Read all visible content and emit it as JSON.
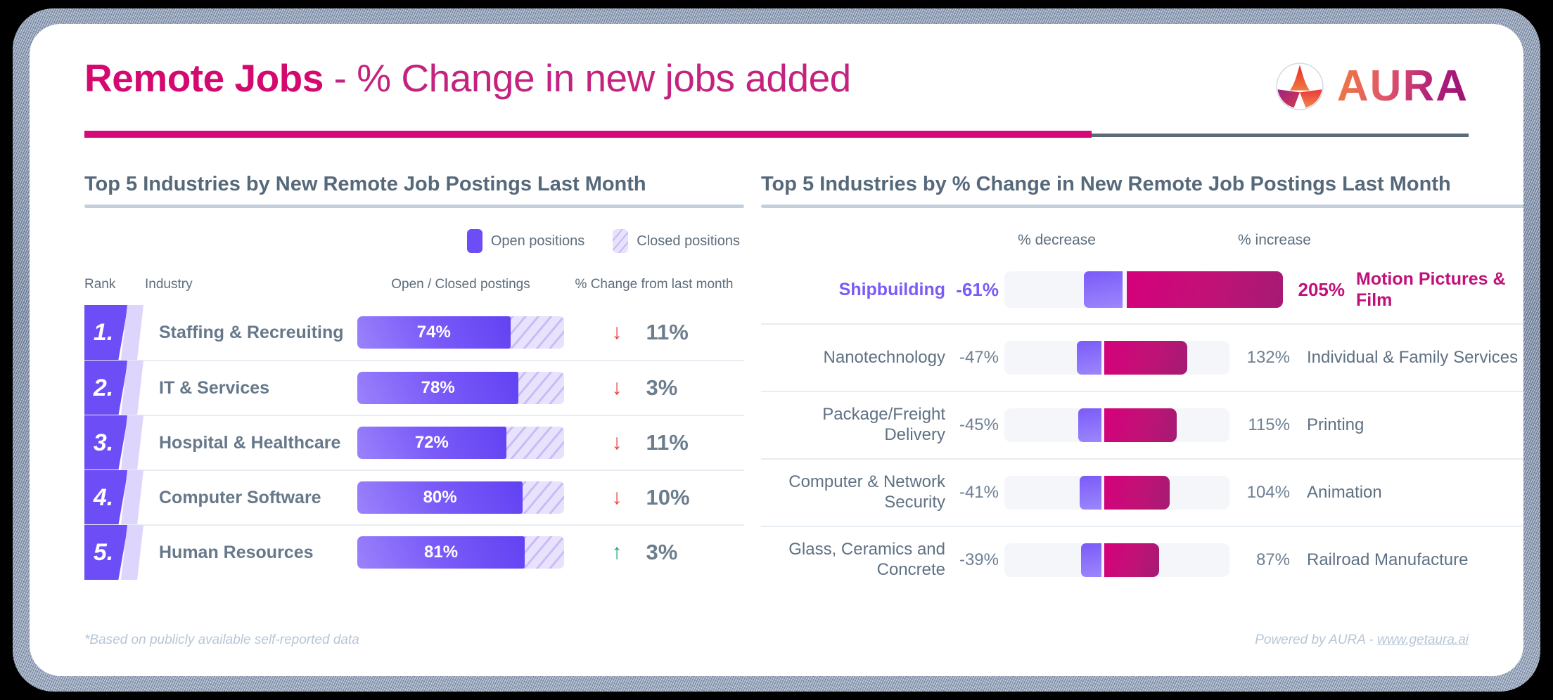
{
  "header": {
    "title_bold": "Remote Jobs",
    "title_rest": " - % Change in new jobs added",
    "logo_text": "AURA",
    "logo_mark": "aura-trident-logo"
  },
  "left_panel": {
    "title": "Top 5 Industries by New Remote Job Postings Last Month",
    "legend": [
      {
        "label": "Open positions",
        "swatch": "#6d4df6"
      },
      {
        "label": "Closed positions",
        "swatch": "#e9e2fd"
      }
    ],
    "columns": {
      "rank": "Rank",
      "industry": "Industry",
      "postings": "Open / Closed postings",
      "change": "% Change from last month"
    },
    "rows": [
      {
        "rank": "1.",
        "industry": "Staffing & Recreuiting",
        "open_pct": 74,
        "open_label": "74%",
        "direction": "down",
        "arrow": "↓",
        "change": "11%"
      },
      {
        "rank": "2.",
        "industry": "IT & Services",
        "open_pct": 78,
        "open_label": "78%",
        "direction": "down",
        "arrow": "↓",
        "change": "3%"
      },
      {
        "rank": "3.",
        "industry": "Hospital & Healthcare",
        "open_pct": 72,
        "open_label": "72%",
        "direction": "down",
        "arrow": "↓",
        "change": "11%"
      },
      {
        "rank": "4.",
        "industry": "Computer Software",
        "open_pct": 80,
        "open_label": "80%",
        "direction": "down",
        "arrow": "↓",
        "change": "10%"
      },
      {
        "rank": "5.",
        "industry": "Human Resources",
        "open_pct": 81,
        "open_label": "81%",
        "direction": "up",
        "arrow": "↑",
        "change": "3%"
      }
    ]
  },
  "right_panel": {
    "title": "Top 5 Industries by % Change in New Remote Job Postings Last Month",
    "axis_left": "% decrease",
    "axis_right": "% increase",
    "rows": [
      {
        "left_name": "Shipbuilding",
        "left_value": "-61%",
        "neg": -61,
        "pos": 205,
        "right_value": "205%",
        "right_name": "Motion Pictures & Film",
        "highlight": true
      },
      {
        "left_name": "Nanotechnology",
        "left_value": "-47%",
        "neg": -47,
        "pos": 132,
        "right_value": "132%",
        "right_name": "Individual & Family Services",
        "highlight": false
      },
      {
        "left_name": "Package/Freight Delivery",
        "left_value": "-45%",
        "neg": -45,
        "pos": 115,
        "right_value": "115%",
        "right_name": "Printing",
        "highlight": false
      },
      {
        "left_name": "Computer & Network Security",
        "left_value": "-41%",
        "neg": -41,
        "pos": 104,
        "right_value": "104%",
        "right_name": "Animation",
        "highlight": false
      },
      {
        "left_name": "Glass, Ceramics and Concrete",
        "left_value": "-39%",
        "neg": -39,
        "pos": 87,
        "right_value": "87%",
        "right_name": "Railroad Manufacture",
        "highlight": false
      }
    ]
  },
  "footer": {
    "note": "*Based on publicly available self-reported data",
    "powered_prefix": "Powered by AURA - ",
    "powered_link": "www.getaura.ai"
  },
  "chart_data": [
    {
      "type": "bar",
      "title": "Top 5 Industries by New Remote Job Postings Last Month",
      "categories": [
        "Staffing & Recreuiting",
        "IT & Services",
        "Hospital & Healthcare",
        "Computer Software",
        "Human Resources"
      ],
      "series": [
        {
          "name": "Open positions",
          "values": [
            74,
            78,
            72,
            80,
            81
          ]
        },
        {
          "name": "Closed positions",
          "values": [
            26,
            22,
            28,
            20,
            19
          ]
        }
      ],
      "annotations": [
        "-11%",
        "-3%",
        "-11%",
        "-10%",
        "+3%"
      ],
      "xlabel": "Open / Closed postings",
      "ylabel": "",
      "ylim": [
        0,
        100
      ],
      "grid": false,
      "legend": "top-right"
    },
    {
      "type": "bar",
      "title": "Top 5 Industries by % Change in New Remote Job Postings Last Month",
      "categories": [
        "row-1",
        "row-2",
        "row-3",
        "row-4",
        "row-5"
      ],
      "series": [
        {
          "name": "% decrease",
          "values": [
            -61,
            -47,
            -45,
            -41,
            -39
          ],
          "categories": [
            "Shipbuilding",
            "Nanotechnology",
            "Package/Freight Delivery",
            "Computer & Network Security",
            "Glass, Ceramics and Concrete"
          ]
        },
        {
          "name": "% increase",
          "values": [
            205,
            132,
            115,
            104,
            87
          ],
          "categories": [
            "Motion Pictures & Film",
            "Individual & Family Services",
            "Printing",
            "Animation",
            "Railroad Manufacture"
          ]
        }
      ],
      "xlabel": "",
      "ylabel": "",
      "xlim": [
        -61,
        205
      ],
      "grid": false,
      "legend": "none"
    }
  ]
}
